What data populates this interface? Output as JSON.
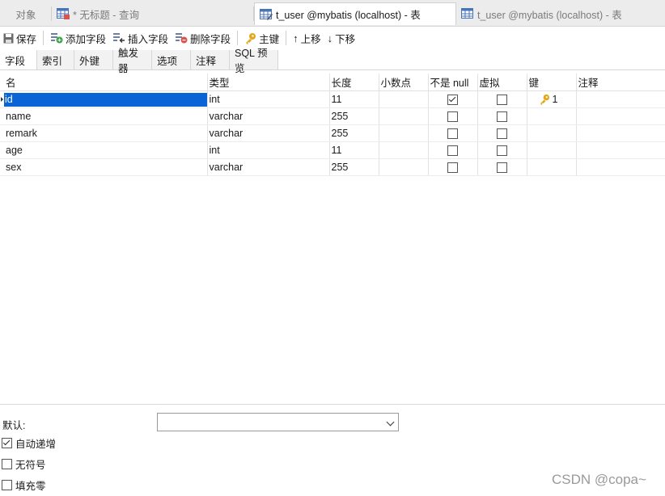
{
  "doc_tabs": [
    {
      "label": "对象"
    },
    {
      "label": "* 无标题 - 查询"
    },
    {
      "label": "t_user @mybatis (localhost) - 表"
    },
    {
      "label": "t_user @mybatis (localhost) - 表"
    }
  ],
  "toolbar": {
    "save": "保存",
    "add_field": "添加字段",
    "insert_field": "插入字段",
    "delete_field": "删除字段",
    "primary_key": "主键",
    "move_up": "上移",
    "move_down": "下移"
  },
  "sub_tabs": [
    "字段",
    "索引",
    "外键",
    "触发器",
    "选项",
    "注释",
    "SQL 预览"
  ],
  "columns": [
    "名",
    "类型",
    "长度",
    "小数点",
    "不是 null",
    "虚拟",
    "键",
    "注释"
  ],
  "rows": [
    {
      "name": "id",
      "type": "int",
      "length": "11",
      "not_null": true,
      "virtual": false,
      "key": "1"
    },
    {
      "name": "name",
      "type": "varchar",
      "length": "255",
      "not_null": false,
      "virtual": false,
      "key": ""
    },
    {
      "name": "remark",
      "type": "varchar",
      "length": "255",
      "not_null": false,
      "virtual": false,
      "key": ""
    },
    {
      "name": "age",
      "type": "int",
      "length": "11",
      "not_null": false,
      "virtual": false,
      "key": ""
    },
    {
      "name": "sex",
      "type": "varchar",
      "length": "255",
      "not_null": false,
      "virtual": false,
      "key": ""
    }
  ],
  "props": {
    "default_label": "默认:",
    "default_value": "",
    "auto_increment": {
      "label": "自动递增",
      "checked": true
    },
    "unsigned": {
      "label": "无符号",
      "checked": false
    },
    "zerofill": {
      "label": "填充零",
      "checked": false
    }
  },
  "watermark": "CSDN @copa~",
  "colors": {
    "selection": "#0a64d6",
    "key_gold": "#d9a21b"
  }
}
